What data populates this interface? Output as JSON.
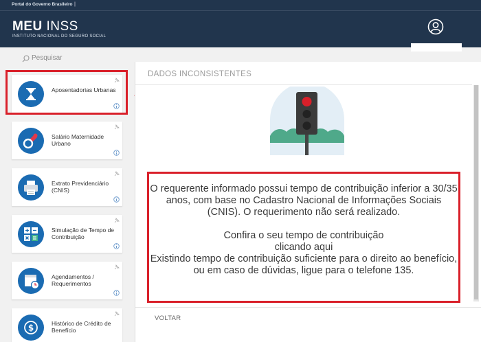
{
  "gov_bar": {
    "label": "Portal do Governo Brasileiro",
    "separator": "|"
  },
  "header": {
    "brand_bold": "MEU",
    "brand_rest": " INSS",
    "subtitle": "INSTITUTO NACIONAL DO SEGURO SOCIAL",
    "user_icon": "user-circle-icon"
  },
  "sidebar": {
    "search_placeholder": "Pesquisar",
    "items": [
      {
        "label": "Aposentadorias Urbanas",
        "icon": "hourglass-icon"
      },
      {
        "label": "Salário Maternidade Urbano",
        "icon": "pacifier-icon"
      },
      {
        "label": "Extrato Previdenciário (CNIS)",
        "icon": "printer-icon"
      },
      {
        "label": "Simulação de Tempo de Contribuição",
        "icon": "calculator-icon"
      },
      {
        "label": "Agendamentos / Requerimentos",
        "icon": "calendar-clock-icon"
      },
      {
        "label": "Histórico de Crédito de Benefício",
        "icon": "dollar-icon"
      }
    ]
  },
  "panel": {
    "title": "DADOS INCONSISTENTES",
    "message_1": "O requerente informado possui tempo de contribuição inferior a 30/35 anos, com base no Cadastro Nacional de Informações Sociais (CNIS). O requerimento não será realizado.",
    "message_2": "Confira o seu tempo de contribuição",
    "link": "clicando aqui",
    "message_3": "Existindo tempo de contribuição suficiente para o direito ao benefício, ou em caso de dúvidas, ligue para o telefone 135.",
    "back_button": "VOLTAR"
  },
  "colors": {
    "header": "#21354d",
    "accent": "#1a6bb2",
    "highlight": "#d9202a"
  }
}
